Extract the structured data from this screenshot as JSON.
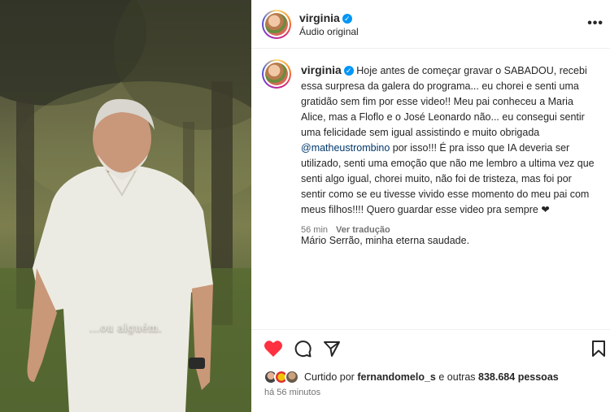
{
  "media": {
    "overlay_caption": "...ou alguém."
  },
  "header": {
    "username": "virginia",
    "audio_label": "Áudio original",
    "more_label": "•••"
  },
  "post": {
    "username": "virginia",
    "text_part1": "Hoje antes de começar gravar o SABADOU, recebi essa surpresa da galera do programa... eu chorei e senti uma gratidão sem fim por esse video!! Meu pai conheceu a Maria Alice, mas a Floflo e o José Leonardo não... eu consegui sentir uma felicidade sem igual assistindo e muito obrigada ",
    "mention": "@matheustrombino",
    "text_part2": " por isso!!! É pra isso que IA deveria ser utilizado, senti uma emoção que não me lembro a ultima vez que senti algo igual, chorei muito, não foi de tristeza, mas foi por sentir como se eu tivesse vivido esse momento do meu pai com meus filhos!!!! Quero guardar esse video pra sempre ❤",
    "signature": "Mário Serrão, minha eterna saudade.",
    "time_ago": "56 min",
    "translate_label": "Ver tradução"
  },
  "actions": {
    "liked": true,
    "like_icon": "heart-filled-icon",
    "comment_icon": "comment-icon",
    "share_icon": "send-icon",
    "save_icon": "bookmark-icon",
    "liked_by_prefix": "Curtido por",
    "liked_by_user": "fernandomelo_s",
    "liked_by_and": "e outras",
    "liked_by_count": "838.684 pessoas",
    "posted_ago": "há 56 minutos"
  },
  "colors": {
    "like_red": "#ff3040",
    "verified_blue": "#0095f6",
    "mention_blue": "#00376b",
    "secondary_text": "#737373"
  }
}
